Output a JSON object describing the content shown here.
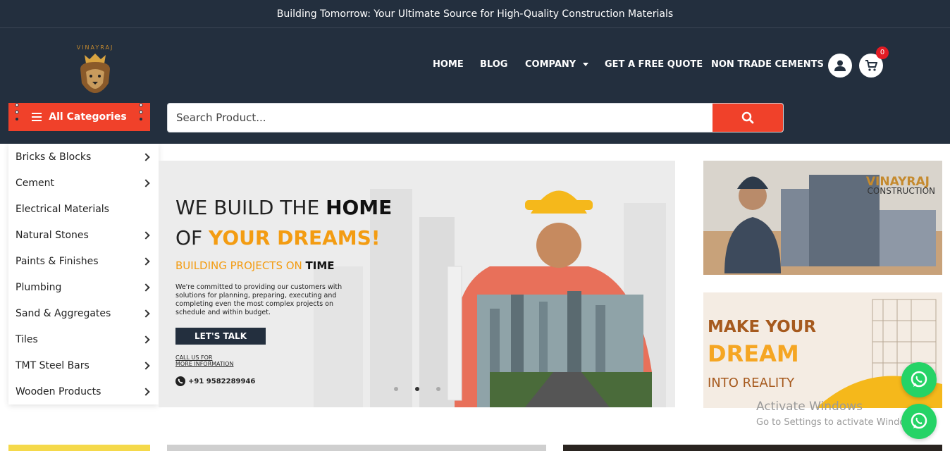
{
  "announcement": "Building Tomorrow: Your Ultimate Source for High-Quality Construction Materials",
  "logo": {
    "text": "VINAYRAJ"
  },
  "nav": [
    {
      "label": "HOME"
    },
    {
      "label": "BLOG"
    },
    {
      "label": "COMPANY"
    },
    {
      "label": "GET A FREE QUOTE"
    },
    {
      "label": "NON TRADE CEMENTS"
    }
  ],
  "cart": {
    "count": "0"
  },
  "categories_button": "All Categories",
  "search": {
    "placeholder": "Search Product..."
  },
  "categories": [
    {
      "label": "Bricks & Blocks",
      "has_sub": true
    },
    {
      "label": "Cement",
      "has_sub": true
    },
    {
      "label": "Electrical Materials",
      "has_sub": false
    },
    {
      "label": "Natural Stones",
      "has_sub": true
    },
    {
      "label": "Paints & Finishes",
      "has_sub": true
    },
    {
      "label": "Plumbing",
      "has_sub": true
    },
    {
      "label": "Sand & Aggregates",
      "has_sub": true
    },
    {
      "label": "Tiles",
      "has_sub": true
    },
    {
      "label": "TMT Steel Bars",
      "has_sub": true
    },
    {
      "label": "Wooden Products",
      "has_sub": true
    }
  ],
  "banner": {
    "line1_a": "WE BUILD THE ",
    "line1_b": "HOME",
    "line2_a": "OF ",
    "line2_b": "YOUR DREAMS!",
    "sub_a": "BUILDING PROJECTS ON ",
    "sub_b": "TIME",
    "text": "We're committed to providing our customers with solutions for planning, preparing, executing and completing even the most complex projects on schedule and within budget.",
    "cta": "LET'S TALK",
    "call_1": "CALL US FOR",
    "call_2": "MORE INFORMATION",
    "phone": "+91 9582289946"
  },
  "side_banner_1": {
    "title": "VINAYRAJ",
    "subtitle": "CONSTRUCTION"
  },
  "side_banner_2": {
    "line1": "MAKE YOUR",
    "line2": "DREAM",
    "line3": "INTO REALITY"
  },
  "watermark": {
    "line1": "Activate Windows",
    "line2": "Go to Settings to activate Windows."
  },
  "colors": {
    "header_bg": "#232f3e",
    "accent": "#f0412a",
    "highlight": "#f39c12",
    "whatsapp": "#25d366"
  }
}
